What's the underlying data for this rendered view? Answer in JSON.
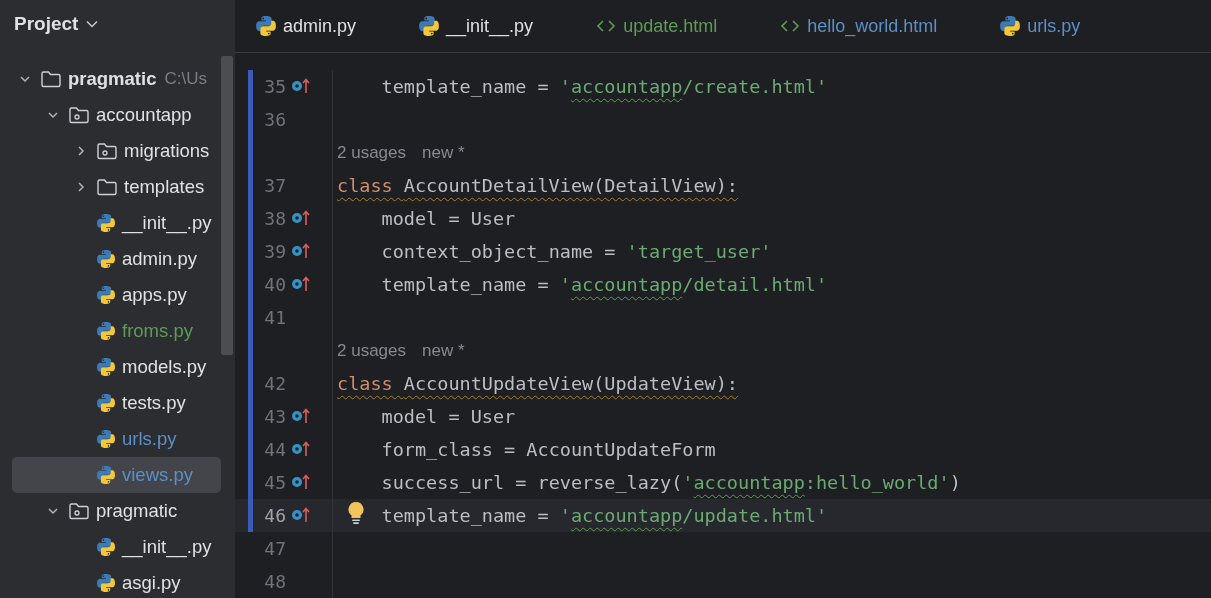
{
  "sidebar": {
    "title": "Project",
    "tree": [
      {
        "name": "pragmatic",
        "kind": "folder",
        "bold": true,
        "path": "C:\\Us",
        "expanded": true,
        "children": [
          {
            "name": "accountapp",
            "kind": "module",
            "bold": false,
            "expanded": true,
            "children": [
              {
                "name": "migrations",
                "kind": "module",
                "bold": false,
                "expanded": false
              },
              {
                "name": "templates",
                "kind": "folder",
                "bold": false,
                "expanded": false
              },
              {
                "name": "__init__.py",
                "kind": "python",
                "selected": false
              },
              {
                "name": "admin.py",
                "kind": "python",
                "selected": false
              },
              {
                "name": "apps.py",
                "kind": "python",
                "selected": false
              },
              {
                "name": "froms.py",
                "kind": "python",
                "color": "#5e9c54",
                "selected": false
              },
              {
                "name": "models.py",
                "kind": "python",
                "selected": false
              },
              {
                "name": "tests.py",
                "kind": "python",
                "selected": false
              },
              {
                "name": "urls.py",
                "kind": "python",
                "color": "#5b8fc7",
                "selected": false
              },
              {
                "name": "views.py",
                "kind": "python",
                "color": "#5b8fc7",
                "selected": true
              }
            ]
          },
          {
            "name": "pragmatic",
            "kind": "module",
            "bold": false,
            "expanded": true,
            "children": [
              {
                "name": "__init__.py",
                "kind": "python",
                "selected": false
              },
              {
                "name": "asgi.py",
                "kind": "python",
                "selected": false
              }
            ]
          }
        ]
      }
    ]
  },
  "tabs": [
    {
      "label": "admin.py",
      "kind": "python",
      "selected": false
    },
    {
      "label": "__init__.py",
      "kind": "python",
      "selected": false
    },
    {
      "label": "update.html",
      "kind": "html",
      "color": "#5e9c54",
      "selected": false
    },
    {
      "label": "hello_world.html",
      "kind": "html",
      "color": "#5b8fc7",
      "selected": false
    },
    {
      "label": "urls.py",
      "kind": "python",
      "color": "#5b8fc7",
      "selected": false
    }
  ],
  "editor": {
    "lines": [
      {
        "kind": "code",
        "number": "35",
        "override": true,
        "changed": true,
        "current": false,
        "warning": false,
        "segments": [
          {
            "kind": "plain",
            "text": "    template_name = "
          },
          {
            "kind": "string",
            "text": "'"
          },
          {
            "kind": "string-typo",
            "text": "accountapp"
          },
          {
            "kind": "string",
            "text": "/create.html'"
          }
        ]
      },
      {
        "kind": "code",
        "number": "36",
        "override": false,
        "changed": true,
        "current": false
      },
      {
        "kind": "hint",
        "changed": true,
        "usages": "2 usages",
        "author": "new *"
      },
      {
        "kind": "code",
        "number": "37",
        "override": false,
        "changed": true,
        "current": false,
        "warning": true,
        "segments": [
          {
            "kind": "keyword",
            "text": "class "
          },
          {
            "kind": "plain",
            "text": "AccountDetailView(DetailView):"
          }
        ]
      },
      {
        "kind": "code",
        "number": "38",
        "override": true,
        "changed": true,
        "current": false,
        "warning": false,
        "segments": [
          {
            "kind": "plain",
            "text": "    model = User"
          }
        ]
      },
      {
        "kind": "code",
        "number": "39",
        "override": true,
        "changed": true,
        "current": false,
        "warning": false,
        "segments": [
          {
            "kind": "plain",
            "text": "    context_object_name = "
          },
          {
            "kind": "string",
            "text": "'target_user'"
          }
        ]
      },
      {
        "kind": "code",
        "number": "40",
        "override": true,
        "changed": true,
        "current": false,
        "warning": false,
        "segments": [
          {
            "kind": "plain",
            "text": "    template_name = "
          },
          {
            "kind": "string",
            "text": "'"
          },
          {
            "kind": "string-typo",
            "text": "accountapp"
          },
          {
            "kind": "string",
            "text": "/detail.html'"
          }
        ]
      },
      {
        "kind": "code",
        "number": "41",
        "override": false,
        "changed": true,
        "current": false
      },
      {
        "kind": "hint",
        "changed": true,
        "usages": "2 usages",
        "author": "new *"
      },
      {
        "kind": "code",
        "number": "42",
        "override": false,
        "changed": true,
        "current": false,
        "warning": true,
        "segments": [
          {
            "kind": "keyword",
            "text": "class "
          },
          {
            "kind": "plain",
            "text": "AccountUpdateView(UpdateView):"
          }
        ]
      },
      {
        "kind": "code",
        "number": "43",
        "override": true,
        "changed": true,
        "current": false,
        "warning": false,
        "segments": [
          {
            "kind": "plain",
            "text": "    model = User"
          }
        ]
      },
      {
        "kind": "code",
        "number": "44",
        "override": true,
        "changed": true,
        "current": false,
        "warning": false,
        "segments": [
          {
            "kind": "plain",
            "text": "    form_class = AccountUpdateForm"
          }
        ]
      },
      {
        "kind": "code",
        "number": "45",
        "override": true,
        "changed": true,
        "current": false,
        "warning": false,
        "segments": [
          {
            "kind": "plain",
            "text": "    success_url = reverse_lazy("
          },
          {
            "kind": "string",
            "text": "'"
          },
          {
            "kind": "string-typo",
            "text": "accountapp"
          },
          {
            "kind": "string",
            "text": ":hello_world'"
          },
          {
            "kind": "plain",
            "text": ")"
          }
        ]
      },
      {
        "kind": "code",
        "number": "46",
        "override": true,
        "changed": true,
        "current": true,
        "bulb": true,
        "warning": false,
        "segments": [
          {
            "kind": "plain",
            "text": "    template_name = "
          },
          {
            "kind": "string",
            "text": "'"
          },
          {
            "kind": "string-typo",
            "text": "accountapp"
          },
          {
            "kind": "string",
            "text": "/update.html'"
          }
        ]
      },
      {
        "kind": "code",
        "number": "47",
        "override": false,
        "changed": false,
        "current": false
      },
      {
        "kind": "code",
        "number": "48",
        "override": false,
        "changed": false,
        "current": false
      }
    ]
  }
}
